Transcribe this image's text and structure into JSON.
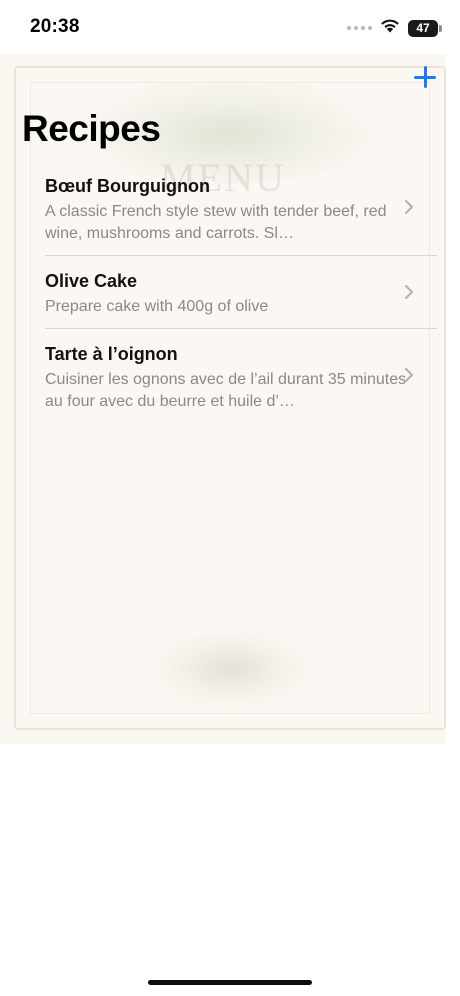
{
  "status_bar": {
    "time": "20:38",
    "battery": "47",
    "icons": [
      "cellular-signal-icon",
      "wifi-icon",
      "battery-icon"
    ]
  },
  "nav": {
    "title": "Recipes",
    "add_icon": "plus-icon",
    "accent_color": "#1d7af5"
  },
  "background": {
    "watermark": "MENU"
  },
  "recipes": [
    {
      "title": "Bœuf Bourguignon",
      "description": "A classic French style stew with tender beef, red wine, mushrooms and carrots. Sl…"
    },
    {
      "title": "Olive Cake",
      "description": "Prepare cake with 400g of olive"
    },
    {
      "title": "Tarte à l’oignon",
      "description": "Cuisiner les ognons avec de l’ail durant 35 minutes au four avec du beurre et huile d’…"
    }
  ]
}
